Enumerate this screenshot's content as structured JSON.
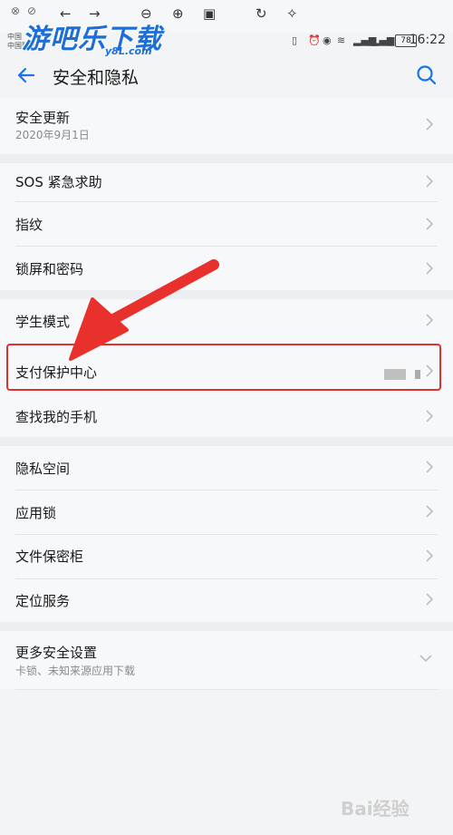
{
  "status_bar": {
    "carrier_line1": "中国",
    "carrier_line2": "中国联通",
    "watermark_logo": "游吧乐下载",
    "watermark_sub": "y8L.com",
    "battery": "78",
    "time": "16:22"
  },
  "header": {
    "title": "安全和隐私"
  },
  "groups": [
    {
      "items": [
        {
          "label": "安全更新",
          "sub": "2020年9月1日"
        }
      ]
    },
    {
      "items": [
        {
          "label": "SOS 紧急求助"
        },
        {
          "label": "指纹"
        },
        {
          "label": "锁屏和密码"
        }
      ]
    },
    {
      "items": [
        {
          "label": "学生模式"
        },
        {
          "label": "支付保护中心"
        },
        {
          "label": "查找我的手机"
        }
      ]
    },
    {
      "items": [
        {
          "label": "隐私空间"
        },
        {
          "label": "应用锁"
        },
        {
          "label": "文件保密柜"
        },
        {
          "label": "定位服务"
        }
      ]
    },
    {
      "items": [
        {
          "label": "更多安全设置",
          "sub": "卡锁、未知来源应用下载"
        }
      ]
    }
  ],
  "watermark_bottom": "Bai经验",
  "colors": {
    "accent": "#1a73e8",
    "highlight": "#e03030"
  }
}
